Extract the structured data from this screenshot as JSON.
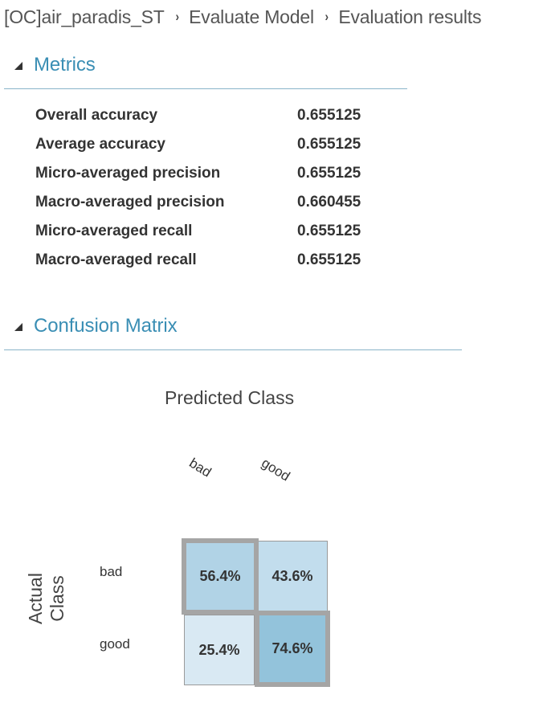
{
  "breadcrumb": {
    "items": [
      "[OC]air_paradis_ST",
      "Evaluate Model",
      "Evaluation results"
    ],
    "separator": "›"
  },
  "metrics": {
    "title": "Metrics",
    "rows": [
      {
        "label": "Overall accuracy",
        "value": "0.655125"
      },
      {
        "label": "Average accuracy",
        "value": "0.655125"
      },
      {
        "label": "Micro-averaged precision",
        "value": "0.655125"
      },
      {
        "label": "Macro-averaged precision",
        "value": "0.660455"
      },
      {
        "label": "Micro-averaged recall",
        "value": "0.655125"
      },
      {
        "label": "Macro-averaged recall",
        "value": "0.655125"
      }
    ]
  },
  "confusion_matrix": {
    "title": "Confusion Matrix",
    "predicted_axis": "Predicted Class",
    "actual_axis": "Actual Class",
    "columns": [
      "bad",
      "good"
    ],
    "rows": [
      "bad",
      "good"
    ],
    "cells": [
      [
        "56.4%",
        "43.6%"
      ],
      [
        "25.4%",
        "74.6%"
      ]
    ],
    "cell_colors": [
      [
        "#b1d3e6",
        "#c2dded"
      ],
      [
        "#d9e9f3",
        "#93c3db"
      ]
    ],
    "highlight_border_color": "#a5a5a5"
  }
}
